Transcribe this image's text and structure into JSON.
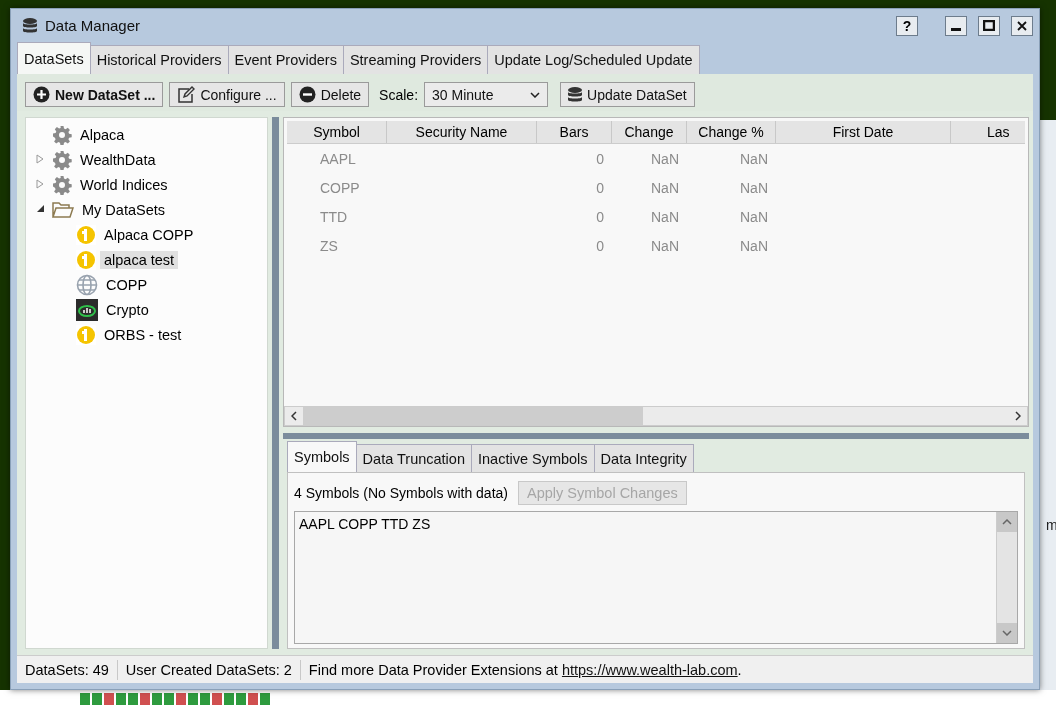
{
  "window": {
    "title": "Data Manager",
    "help_button": "?"
  },
  "tabs": [
    {
      "label": "DataSets",
      "selected": true
    },
    {
      "label": "Historical Providers",
      "selected": false
    },
    {
      "label": "Event Providers",
      "selected": false
    },
    {
      "label": "Streaming Providers",
      "selected": false
    },
    {
      "label": "Update Log/Scheduled Update",
      "selected": false
    }
  ],
  "toolbar": {
    "new_button": "New DataSet ...",
    "configure_button": "Configure ...",
    "delete_button": "Delete",
    "scale_label": "Scale:",
    "scale_value": "30 Minute",
    "update_button": "Update DataSet"
  },
  "tree": [
    {
      "label": "Alpaca",
      "kind": "gear",
      "selected": false
    },
    {
      "label": "WealthData",
      "kind": "gear",
      "expanded": false,
      "selected": false
    },
    {
      "label": "World Indices",
      "kind": "gear",
      "expanded": false,
      "selected": false
    },
    {
      "label": "My DataSets",
      "kind": "folder",
      "expanded": true,
      "selected": false,
      "children": [
        {
          "label": "Alpaca COPP",
          "kind": "alpaca",
          "selected": false
        },
        {
          "label": "alpaca test",
          "kind": "alpaca",
          "selected": true
        },
        {
          "label": "COPP",
          "kind": "globe",
          "selected": false
        },
        {
          "label": "Crypto",
          "kind": "crypto",
          "selected": false
        },
        {
          "label": "ORBS - test",
          "kind": "alpaca",
          "selected": false
        }
      ]
    }
  ],
  "table": {
    "columns": [
      "Symbol",
      "Security Name",
      "Bars",
      "Change",
      "Change %",
      "First Date",
      "Las"
    ],
    "rows": [
      {
        "symbol": "AAPL",
        "bars": "0",
        "change": "NaN",
        "change_pct": "NaN"
      },
      {
        "symbol": "COPP",
        "bars": "0",
        "change": "NaN",
        "change_pct": "NaN"
      },
      {
        "symbol": "TTD",
        "bars": "0",
        "change": "NaN",
        "change_pct": "NaN"
      },
      {
        "symbol": "ZS",
        "bars": "0",
        "change": "NaN",
        "change_pct": "NaN"
      }
    ]
  },
  "lower_tabs": [
    {
      "label": "Symbols",
      "selected": true
    },
    {
      "label": "Data Truncation",
      "selected": false
    },
    {
      "label": "Inactive Symbols",
      "selected": false
    },
    {
      "label": "Data Integrity",
      "selected": false
    }
  ],
  "symbols_panel": {
    "summary": "4 Symbols (No Symbols with data)",
    "apply_button": {
      "label": "Apply Symbol Changes",
      "disabled": true
    },
    "symbols": "AAPL COPP TTD ZS"
  },
  "status_bar": {
    "fields": [
      "DataSets: 49",
      "User Created DataSets: 2"
    ],
    "message": "Find more Data Provider Extensions at",
    "link": "https://www.wealth-lab.com",
    "suffix": "."
  },
  "background_app": {
    "text_fragment": "m"
  }
}
